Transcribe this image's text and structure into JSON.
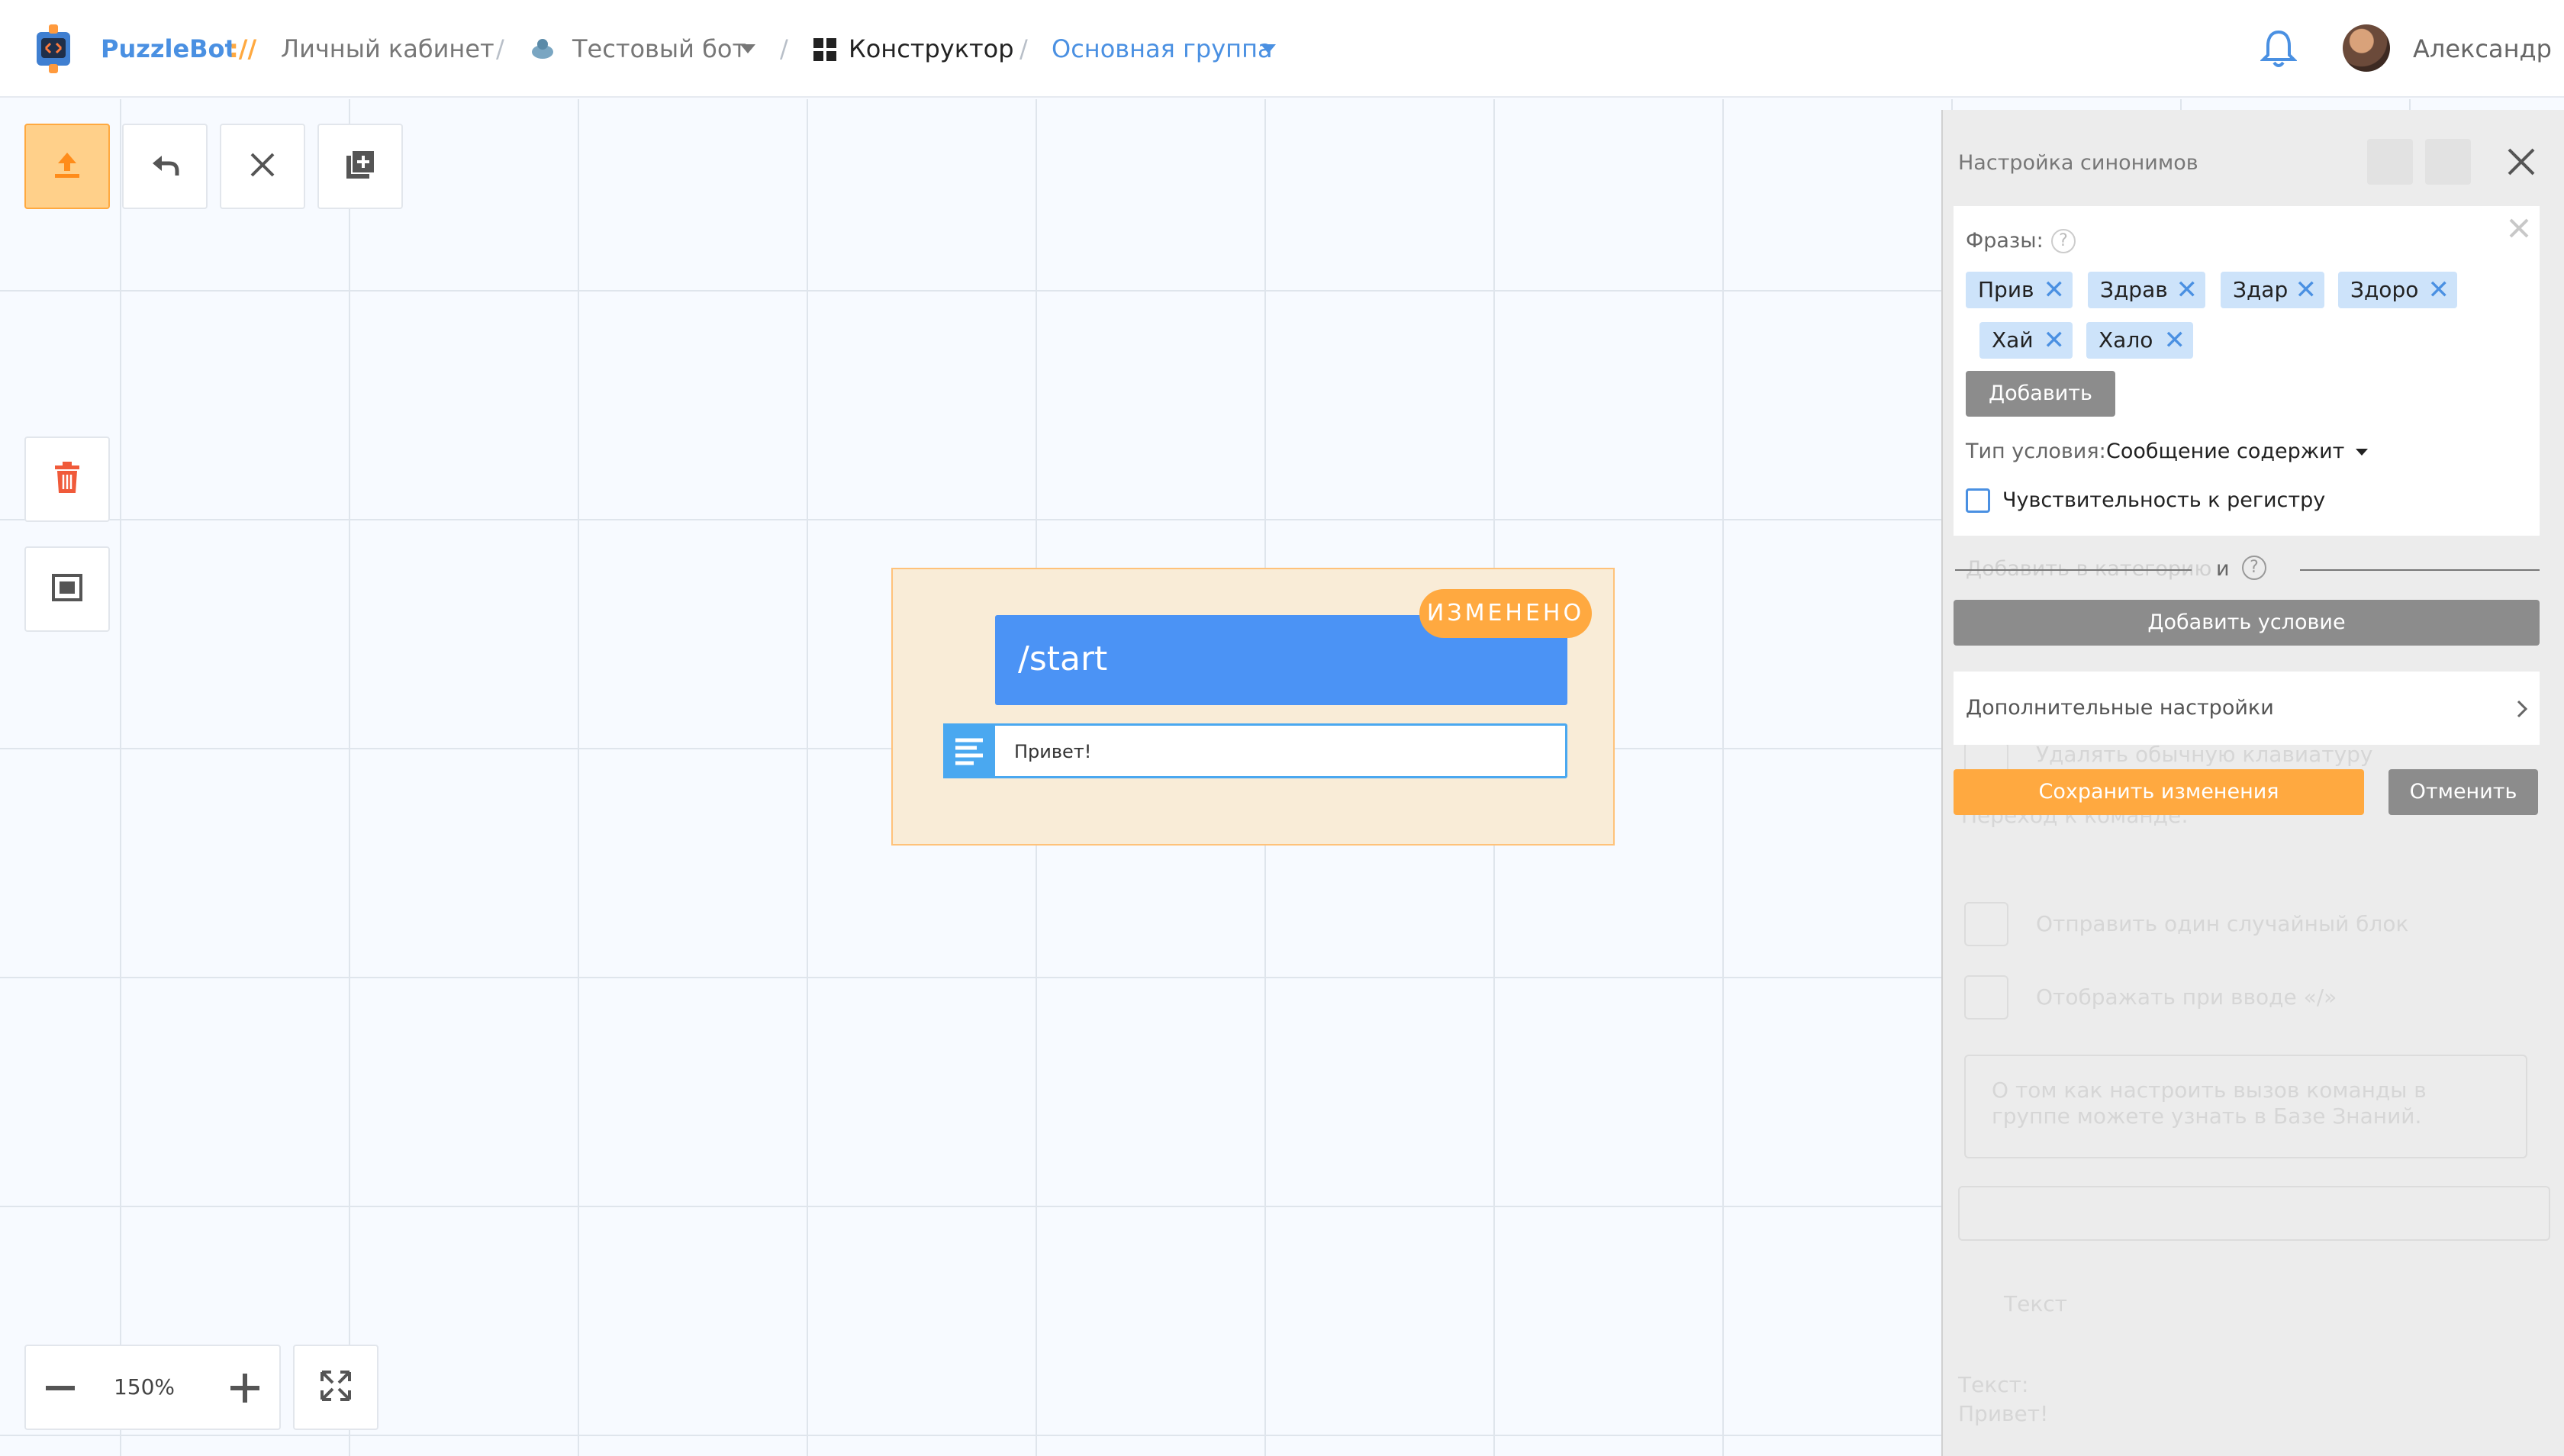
{
  "header": {
    "brand": "PuzzleBot",
    "brand_sep": "://",
    "cabinet": "Личный кабинет",
    "bot_name": "Тестовый бот",
    "constructor": "Конструктор",
    "group": "Основная группа",
    "user_name": "Александр",
    "separator": "/"
  },
  "toolbar": {
    "zoom": "150%"
  },
  "node": {
    "badge": "ИЗМЕНЕНО",
    "command": "/start",
    "message": "Привет!"
  },
  "panel": {
    "title": "Настройка синонимов",
    "phrases_label": "Фразы:",
    "phrases": [
      "Прив",
      "Здрав",
      "Здар",
      "Здоро",
      "Хай",
      "Хало"
    ],
    "add_button": "Добавить",
    "condition_label": "Тип условия:",
    "condition_value": "Сообщение содержит",
    "case_sensitive_label": "Чувствительность к регистру",
    "and_label": "и",
    "category_label": "Добавить в категорию",
    "add_condition": "Добавить условие",
    "extra_settings": "Дополнительные настройки",
    "save": "Сохранить изменения",
    "cancel": "Отменить",
    "bg_remove_keyboard": "Удалять обычную клавиатуру",
    "bg_goto_command": "Переход к команде:",
    "bg_send_random": "Отправить один случайный блок",
    "bg_show_input": "Отображать при вводе «/»",
    "bg_info_text": "О том как настроить вызов команды в группе можете узнать в Базе Знаний.",
    "bg_text_header": "Текст",
    "bg_text_label": "Текст:",
    "bg_text_value": "Привет!"
  },
  "colors": {
    "accent": "#4a90e2",
    "orange": "#ffa940",
    "node_blue": "#4b93f5"
  }
}
